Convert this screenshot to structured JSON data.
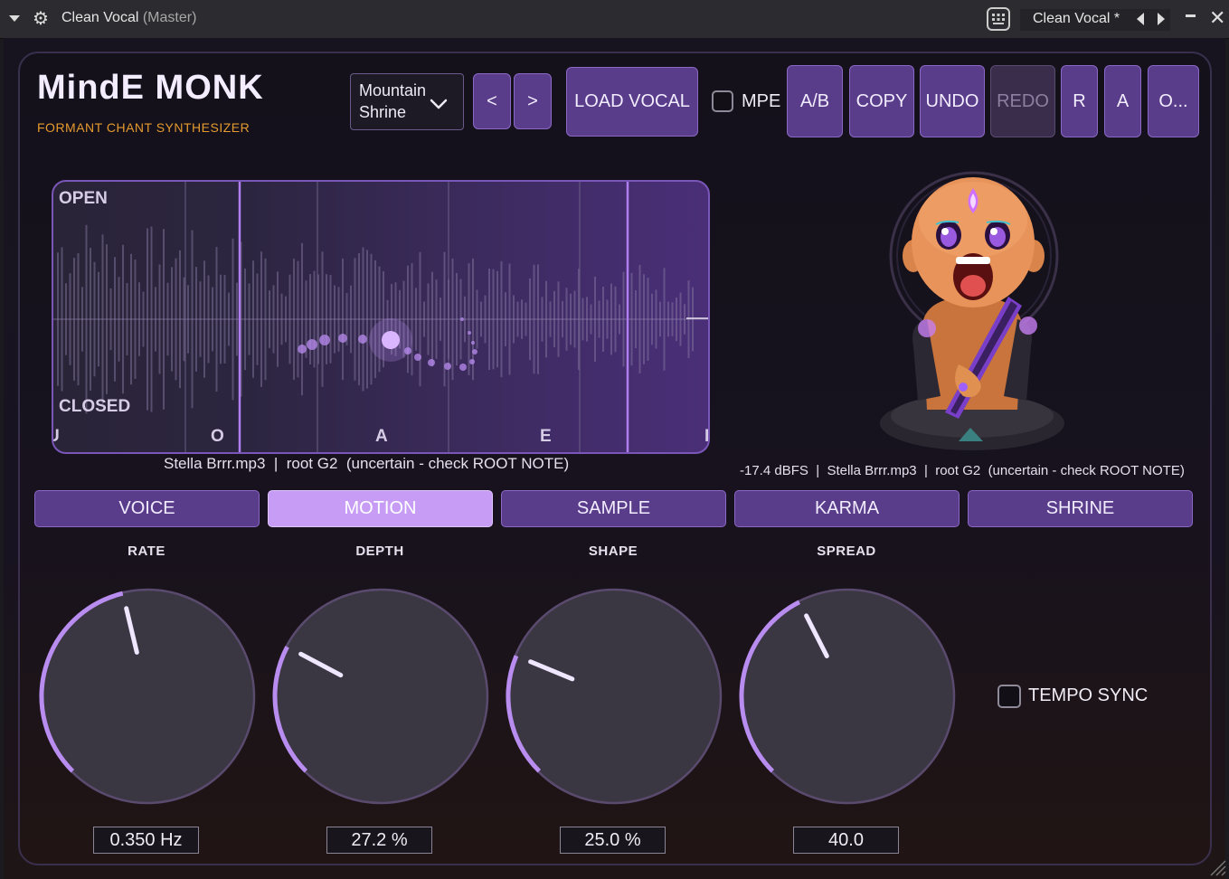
{
  "host": {
    "window_title": "Clean Vocal",
    "window_suffix": "(Master)",
    "preset_name": "Clean Vocal *"
  },
  "plugin": {
    "name": "MindE MONK",
    "subtitle": "FORMANT CHANT SYNTHESIZER"
  },
  "toolbar": {
    "preset_line1": "Mountain",
    "preset_line2": "Shrine",
    "prev_label": "<",
    "next_label": ">",
    "load_label": "LOAD VOCAL",
    "mpe_label": "MPE",
    "mpe_checked": false,
    "ab_label": "A/B",
    "copy_label": "COPY",
    "undo_label": "UNDO",
    "redo_label": "REDO",
    "redo_enabled": false,
    "r_label": "R",
    "a_label": "A",
    "more_label": "O..."
  },
  "waveform": {
    "open_label": "OPEN",
    "closed_label": "CLOSED",
    "vowels": [
      "U",
      "O",
      "A",
      "E",
      "I"
    ],
    "file_info": "Stella Brrr.mp3  |  root G2  (uncertain - check ROOT NOTE)"
  },
  "status": {
    "text": "-17.4 dBFS  |  Stella Brrr.mp3  |  root G2  (uncertain - check ROOT NOTE)"
  },
  "tabs": [
    {
      "label": "VOICE",
      "active": false
    },
    {
      "label": "MOTION",
      "active": true
    },
    {
      "label": "SAMPLE",
      "active": false
    },
    {
      "label": "KARMA",
      "active": false
    },
    {
      "label": "SHRINE",
      "active": false
    }
  ],
  "knobs": [
    {
      "label": "RATE",
      "value": "0.350 Hz",
      "level": 0.45
    },
    {
      "label": "DEPTH",
      "value": "27.2 %",
      "level": 0.27
    },
    {
      "label": "SHAPE",
      "value": "25.0 %",
      "level": 0.25
    },
    {
      "label": "SPREAD",
      "value": "40.0",
      "level": 0.4
    }
  ],
  "tempo_sync": {
    "label": "TEMPO SYNC",
    "checked": false
  },
  "colors": {
    "accent": "#b98cf0",
    "button": "#5a3d8a",
    "active_tab": "#c79cf5",
    "subtitle": "#e59a2e"
  }
}
